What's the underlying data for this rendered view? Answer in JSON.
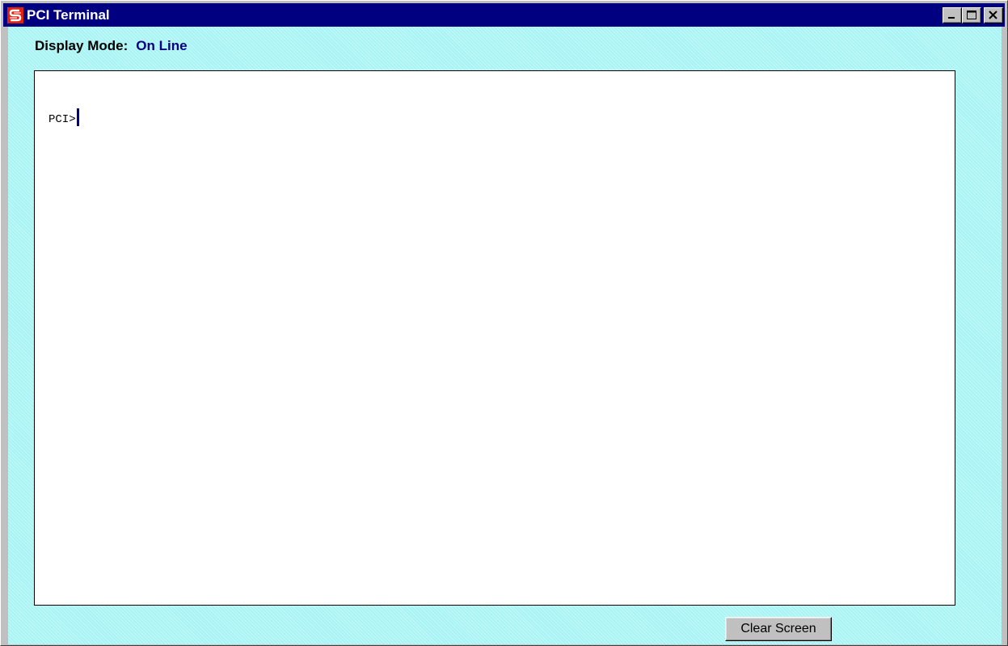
{
  "window": {
    "title": "PCI Terminal",
    "icon": "app-logo-icon",
    "controls": [
      "minimize-icon",
      "maximize-icon",
      "close-icon"
    ]
  },
  "display_mode": {
    "label": "Display Mode:",
    "value": "On Line"
  },
  "terminal": {
    "prompt": "PCI>"
  },
  "actions": {
    "clear_label": "Clear Screen"
  },
  "colors": {
    "titlebar": "#000080",
    "client_background": "#a8f4f4",
    "mode_value": "#000080",
    "icon_red": "#e02010"
  }
}
